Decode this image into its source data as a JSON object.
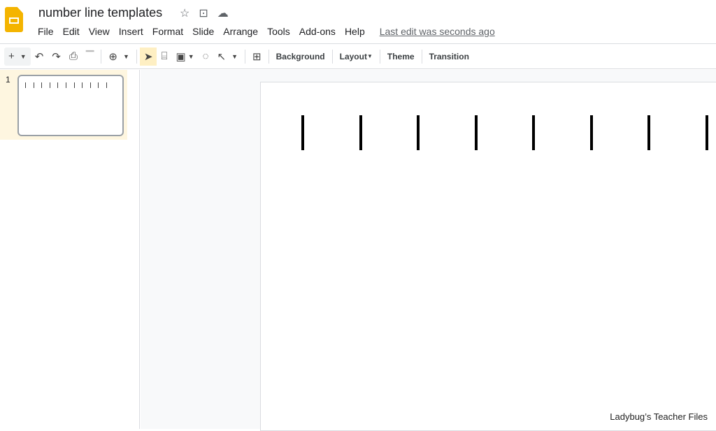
{
  "app": {
    "title": "number line templates",
    "brand_color": "#f4b400"
  },
  "menu": [
    "File",
    "Edit",
    "View",
    "Insert",
    "Format",
    "Slide",
    "Arrange",
    "Tools",
    "Add-ons",
    "Help"
  ],
  "last_edit": "Last edit was seconds ago",
  "toolbar": {
    "background": "Background",
    "layout": "Layout",
    "theme": "Theme",
    "transition": "Transition"
  },
  "slides": [
    {
      "number": "1",
      "tick_count": 11
    }
  ],
  "slide": {
    "visible_ticks": 8
  },
  "watermark": "Ladybug’s Teacher Files"
}
